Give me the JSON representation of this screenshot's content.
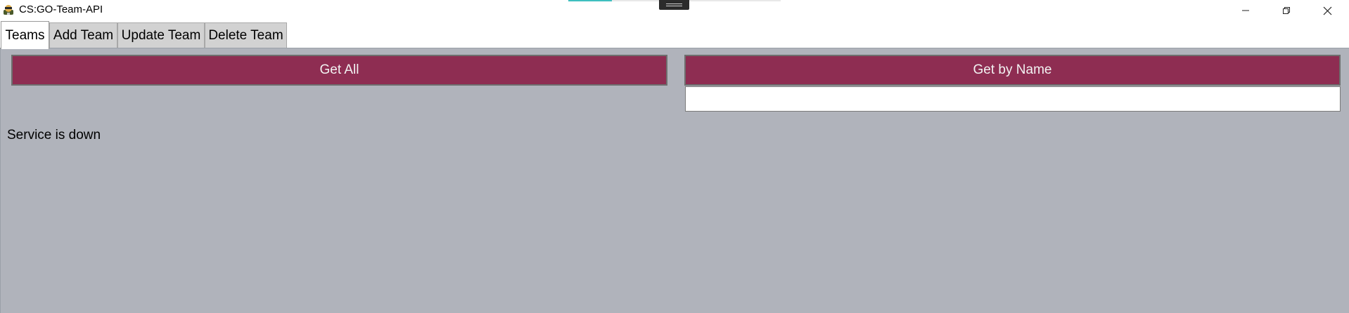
{
  "window": {
    "title": "CS:GO-Team-API"
  },
  "tabs": [
    {
      "label": "Teams",
      "active": true
    },
    {
      "label": "Add Team",
      "active": false
    },
    {
      "label": "Update Team",
      "active": false
    },
    {
      "label": "Delete Team",
      "active": false
    }
  ],
  "teams_tab": {
    "get_all_label": "Get All",
    "get_by_name_label": "Get by Name",
    "name_input_value": "",
    "status_text": "Service is down"
  },
  "colors": {
    "button_bg": "#8e2d52",
    "content_bg": "#b0b3bb",
    "teal_accent": "#3fbfbf"
  },
  "icons": {
    "app": "app-icon",
    "minimize": "minimize-icon",
    "maximize": "restore-icon",
    "close": "close-icon"
  }
}
